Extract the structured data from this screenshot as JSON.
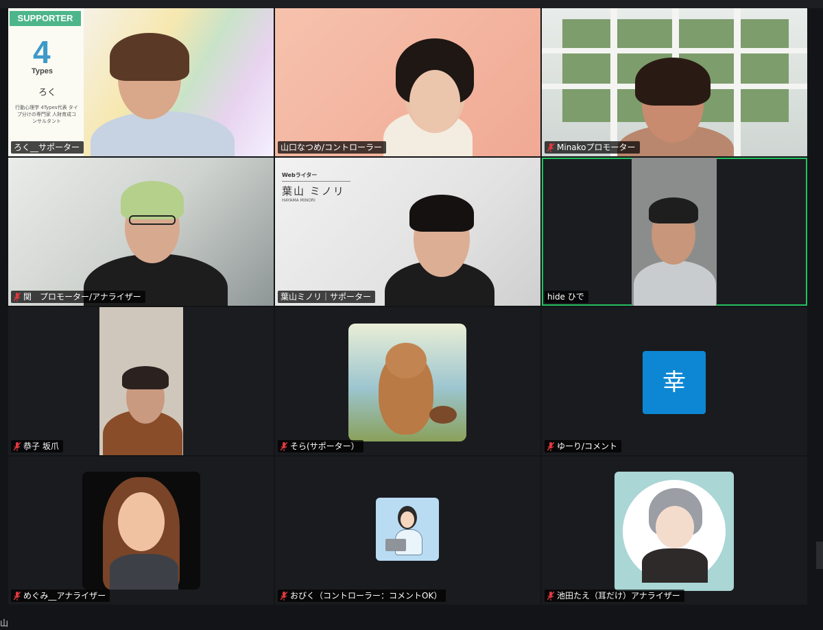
{
  "supporter_banner": {
    "label": "SUPPORTER",
    "logo_number": "4",
    "logo_text": "Types",
    "name": "ろく",
    "description": "行動心理学 4Types代表 タイプ分けの専門家 人財育成コンサルタント"
  },
  "writer_banner": {
    "title": "Webライター",
    "name": "葉山 ミノリ",
    "romaji": "HAYAMA MINORI"
  },
  "avatar_kou": "幸",
  "participants": [
    {
      "name": "ろく__サポーター",
      "muted": false
    },
    {
      "name": "山口なつめ/コントローラー",
      "muted": false
    },
    {
      "name": "Minakoプロモーター",
      "muted": true
    },
    {
      "name": "関　プロモーター/アナライザー",
      "muted": true
    },
    {
      "name": "葉山ミノリ｜サポーター",
      "muted": false
    },
    {
      "name": "hide ひで",
      "muted": false,
      "speaking": true
    },
    {
      "name": "恭子 坂爪",
      "muted": true
    },
    {
      "name": "そら(サポーター）",
      "muted": true
    },
    {
      "name": "ゆーり/コメント",
      "muted": true
    },
    {
      "name": "めぐみ__アナライザー",
      "muted": true
    },
    {
      "name": "おびく（コントローラー：コメントOK）",
      "muted": true
    },
    {
      "name": "池田たえ（耳だけ）アナライザー",
      "muted": true
    }
  ],
  "bottom_edge_text": "山",
  "colors": {
    "background": "#121417",
    "active_speaker_border": "#24c262",
    "muted_icon": "#e0383e",
    "kou_avatar": "#0d87d4"
  }
}
